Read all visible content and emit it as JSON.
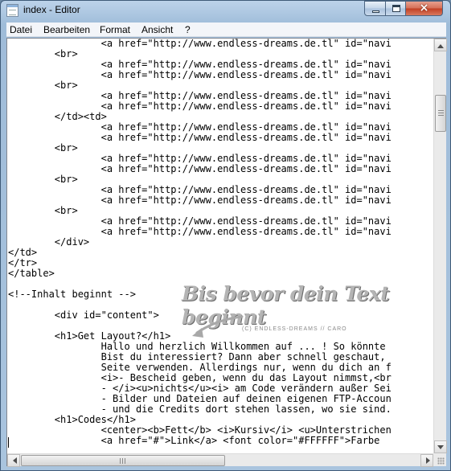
{
  "window": {
    "title": "index - Editor",
    "controls": {
      "close_glyph": "×"
    }
  },
  "menu": [
    "Datei",
    "Bearbeiten",
    "Format",
    "Ansicht",
    "?"
  ],
  "editor": {
    "lines": [
      "                <a href=\"http://www.endless-dreams.de.tl\" id=\"navi",
      "        <br>",
      "                <a href=\"http://www.endless-dreams.de.tl\" id=\"navi",
      "                <a href=\"http://www.endless-dreams.de.tl\" id=\"navi",
      "        <br>",
      "                <a href=\"http://www.endless-dreams.de.tl\" id=\"navi",
      "                <a href=\"http://www.endless-dreams.de.tl\" id=\"navi",
      "        </td><td>",
      "                <a href=\"http://www.endless-dreams.de.tl\" id=\"navi",
      "                <a href=\"http://www.endless-dreams.de.tl\" id=\"navi",
      "        <br>",
      "                <a href=\"http://www.endless-dreams.de.tl\" id=\"navi",
      "                <a href=\"http://www.endless-dreams.de.tl\" id=\"navi",
      "        <br>",
      "                <a href=\"http://www.endless-dreams.de.tl\" id=\"navi",
      "                <a href=\"http://www.endless-dreams.de.tl\" id=\"navi",
      "        <br>",
      "                <a href=\"http://www.endless-dreams.de.tl\" id=\"navi",
      "                <a href=\"http://www.endless-dreams.de.tl\" id=\"navi",
      "        </div>",
      "</td>",
      "</tr>",
      "</table>",
      "",
      "<!--Inhalt beginnt -->",
      "",
      "        <div id=\"content\">",
      "",
      "        <h1>Get Layout?</h1>",
      "                Hallo und herzlich Willkommen auf ... ! So könnte",
      "                Bist du interessiert? Dann aber schnell geschaut,",
      "                Seite verwenden. Allerdings nur, wenn du dich an f",
      "                <i>- Bescheid geben, wenn du das Layout nimmst,<br",
      "                - </i><u>nichts</u><i> am Code verändern außer Sei",
      "                - Bilder und Dateien auf deinen eigenen FTP-Accoun",
      "                - und die Credits dort stehen lassen, wo sie sind.",
      "        <h1>Codes</h1>",
      "                <center><b>Fett</b> <i>Kursiv</i> <u>Unterstrichen",
      "                <a href=\"#\">Link</a> <font color=\"#FFFFFF\">Farbe"
    ]
  },
  "watermark": {
    "text": "Bis bevor dein Text beginnt",
    "credit": "(C) ENDLESS-DREAMS // CARO"
  }
}
